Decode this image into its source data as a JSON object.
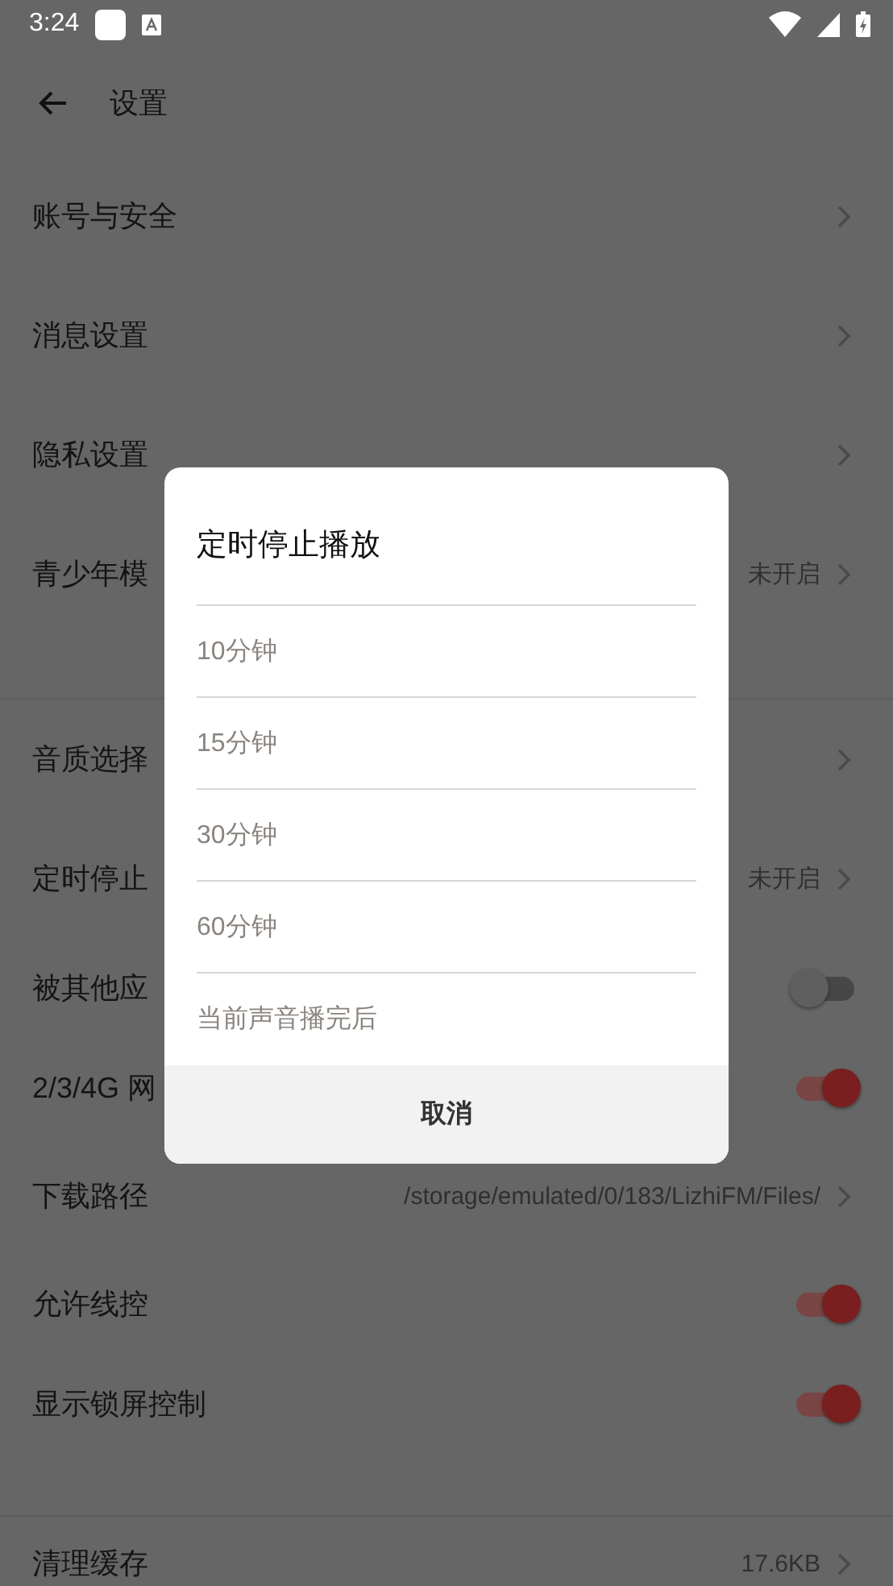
{
  "status_bar": {
    "time": "3:24"
  },
  "toolbar": {
    "title": "设置"
  },
  "sections": [
    {
      "items": [
        {
          "kind": "link",
          "label": "账号与安全"
        },
        {
          "kind": "link",
          "label": "消息设置"
        },
        {
          "kind": "link",
          "label": "隐私设置"
        },
        {
          "kind": "link",
          "label": "青少年模",
          "value": "未开启"
        }
      ]
    },
    {
      "items": [
        {
          "kind": "link",
          "label": "音质选择"
        },
        {
          "kind": "link",
          "label": "定时停止",
          "value": "未开启"
        },
        {
          "kind": "switch",
          "label": "被其他应",
          "on": false
        },
        {
          "kind": "switch",
          "label": "2/3/4G 网",
          "on": true
        },
        {
          "kind": "link",
          "label": "下载路径",
          "value": "/storage/emulated/0/183/LizhiFM/Files/"
        },
        {
          "kind": "switch",
          "label": "允许线控",
          "on": true
        },
        {
          "kind": "switch",
          "label": "显示锁屏控制",
          "on": true
        }
      ]
    },
    {
      "items": [
        {
          "kind": "link",
          "label": "清理缓存",
          "value": "17.6KB"
        }
      ]
    }
  ],
  "dialog": {
    "title": "定时停止播放",
    "options": [
      "10分钟",
      "15分钟",
      "30分钟",
      "60分钟",
      "当前声音播完后"
    ],
    "cancel": "取消"
  }
}
